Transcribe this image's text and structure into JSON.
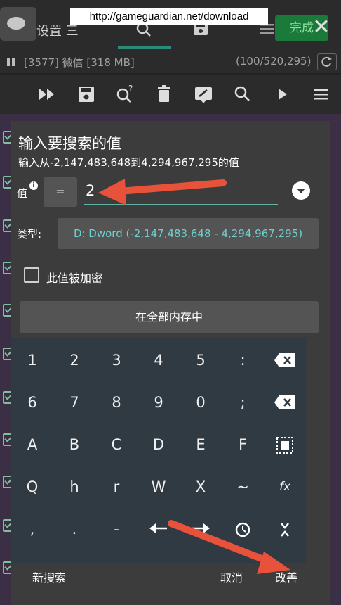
{
  "url_banner": "http://gameguardian.net/download",
  "top": {
    "title": "设置  三",
    "done_label": "完成",
    "close_symbol": "✕"
  },
  "process": {
    "label": "[3577] 微信 [318 MB]",
    "counter": "(100/520,295)"
  },
  "toolbar_icons": [
    "fast-forward-icon",
    "save-icon",
    "search-question-icon",
    "trash-icon",
    "edit-icon",
    "search-icon",
    "play-icon",
    "menu-icon"
  ],
  "dialog": {
    "title": "输入要搜索的值",
    "subtitle": "输入从-2,147,483,648到4,294,967,295的值",
    "value_label": "值",
    "info_symbol": "i",
    "eq_symbol": "=",
    "value": "2",
    "type_label": "类型:",
    "type_value": "D: Dword (-2,147,483,648 - 4,294,967,295)",
    "encrypted_label": "此值被加密",
    "memory_label": "在全部内存中"
  },
  "keypad": {
    "rows": [
      [
        "1",
        "2",
        "3",
        "4",
        "5",
        ":",
        "backspace-icon"
      ],
      [
        "6",
        "7",
        "8",
        "9",
        "0",
        ";",
        "clear-icon"
      ],
      [
        "A",
        "B",
        "C",
        "D",
        "E",
        "F",
        "select-all-icon"
      ],
      [
        "Q",
        "h",
        "r",
        "W",
        "X",
        "~",
        "fx"
      ],
      [
        ",",
        ".",
        "-",
        "arrow-left-icon",
        "arrow-right-icon",
        "history-icon",
        "collapse-icon"
      ]
    ]
  },
  "actions": {
    "new_search": "新搜索",
    "cancel": "取消",
    "refine": "改善"
  },
  "colors": {
    "accent": "#5fb3a8",
    "arrow": "#e8513a",
    "done_bg": "#1b7a3a"
  }
}
